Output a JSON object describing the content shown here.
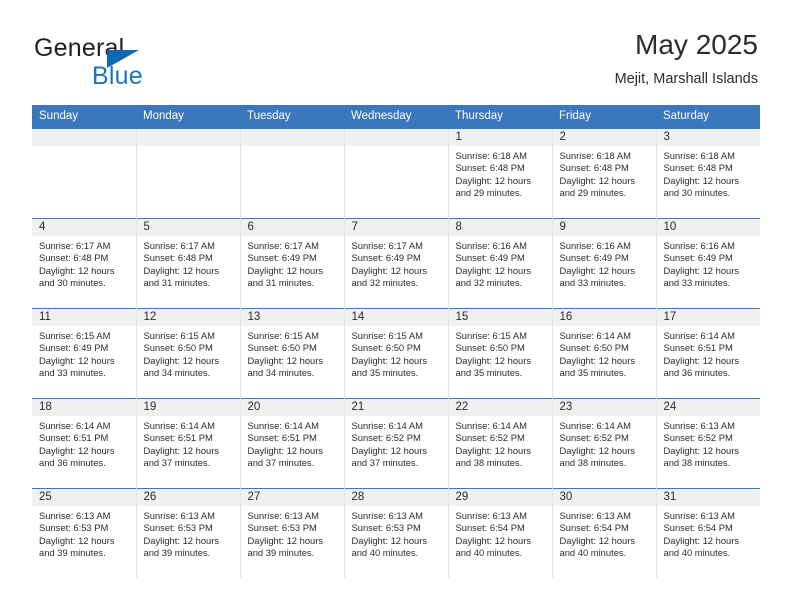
{
  "logo": {
    "primary_text": "General",
    "secondary_text": "Blue",
    "primary_color": "#231f20",
    "secondary_color": "#1b75bb",
    "triangle_color": "#1068b3"
  },
  "header": {
    "title": "May 2025",
    "subtitle": "Mejit, Marshall Islands"
  },
  "colors": {
    "header_row_bg": "#3a77bd",
    "header_row_text": "#ffffff",
    "day_number_band": "#f0f0f0",
    "cell_bg": "#ffffff",
    "row_divider": "#3a77bd",
    "text": "#2b2b2b"
  },
  "weekday_headers": [
    "Sunday",
    "Monday",
    "Tuesday",
    "Wednesday",
    "Thursday",
    "Friday",
    "Saturday"
  ],
  "weeks": [
    [
      {
        "day": "",
        "empty": true
      },
      {
        "day": "",
        "empty": true
      },
      {
        "day": "",
        "empty": true
      },
      {
        "day": "",
        "empty": true
      },
      {
        "day": "1",
        "sunrise": "Sunrise: 6:18 AM",
        "sunset": "Sunset: 6:48 PM",
        "daylight_line1": "Daylight: 12 hours",
        "daylight_line2": "and 29 minutes."
      },
      {
        "day": "2",
        "sunrise": "Sunrise: 6:18 AM",
        "sunset": "Sunset: 6:48 PM",
        "daylight_line1": "Daylight: 12 hours",
        "daylight_line2": "and 29 minutes."
      },
      {
        "day": "3",
        "sunrise": "Sunrise: 6:18 AM",
        "sunset": "Sunset: 6:48 PM",
        "daylight_line1": "Daylight: 12 hours",
        "daylight_line2": "and 30 minutes."
      }
    ],
    [
      {
        "day": "4",
        "sunrise": "Sunrise: 6:17 AM",
        "sunset": "Sunset: 6:48 PM",
        "daylight_line1": "Daylight: 12 hours",
        "daylight_line2": "and 30 minutes."
      },
      {
        "day": "5",
        "sunrise": "Sunrise: 6:17 AM",
        "sunset": "Sunset: 6:48 PM",
        "daylight_line1": "Daylight: 12 hours",
        "daylight_line2": "and 31 minutes."
      },
      {
        "day": "6",
        "sunrise": "Sunrise: 6:17 AM",
        "sunset": "Sunset: 6:49 PM",
        "daylight_line1": "Daylight: 12 hours",
        "daylight_line2": "and 31 minutes."
      },
      {
        "day": "7",
        "sunrise": "Sunrise: 6:17 AM",
        "sunset": "Sunset: 6:49 PM",
        "daylight_line1": "Daylight: 12 hours",
        "daylight_line2": "and 32 minutes."
      },
      {
        "day": "8",
        "sunrise": "Sunrise: 6:16 AM",
        "sunset": "Sunset: 6:49 PM",
        "daylight_line1": "Daylight: 12 hours",
        "daylight_line2": "and 32 minutes."
      },
      {
        "day": "9",
        "sunrise": "Sunrise: 6:16 AM",
        "sunset": "Sunset: 6:49 PM",
        "daylight_line1": "Daylight: 12 hours",
        "daylight_line2": "and 33 minutes."
      },
      {
        "day": "10",
        "sunrise": "Sunrise: 6:16 AM",
        "sunset": "Sunset: 6:49 PM",
        "daylight_line1": "Daylight: 12 hours",
        "daylight_line2": "and 33 minutes."
      }
    ],
    [
      {
        "day": "11",
        "sunrise": "Sunrise: 6:15 AM",
        "sunset": "Sunset: 6:49 PM",
        "daylight_line1": "Daylight: 12 hours",
        "daylight_line2": "and 33 minutes."
      },
      {
        "day": "12",
        "sunrise": "Sunrise: 6:15 AM",
        "sunset": "Sunset: 6:50 PM",
        "daylight_line1": "Daylight: 12 hours",
        "daylight_line2": "and 34 minutes."
      },
      {
        "day": "13",
        "sunrise": "Sunrise: 6:15 AM",
        "sunset": "Sunset: 6:50 PM",
        "daylight_line1": "Daylight: 12 hours",
        "daylight_line2": "and 34 minutes."
      },
      {
        "day": "14",
        "sunrise": "Sunrise: 6:15 AM",
        "sunset": "Sunset: 6:50 PM",
        "daylight_line1": "Daylight: 12 hours",
        "daylight_line2": "and 35 minutes."
      },
      {
        "day": "15",
        "sunrise": "Sunrise: 6:15 AM",
        "sunset": "Sunset: 6:50 PM",
        "daylight_line1": "Daylight: 12 hours",
        "daylight_line2": "and 35 minutes."
      },
      {
        "day": "16",
        "sunrise": "Sunrise: 6:14 AM",
        "sunset": "Sunset: 6:50 PM",
        "daylight_line1": "Daylight: 12 hours",
        "daylight_line2": "and 35 minutes."
      },
      {
        "day": "17",
        "sunrise": "Sunrise: 6:14 AM",
        "sunset": "Sunset: 6:51 PM",
        "daylight_line1": "Daylight: 12 hours",
        "daylight_line2": "and 36 minutes."
      }
    ],
    [
      {
        "day": "18",
        "sunrise": "Sunrise: 6:14 AM",
        "sunset": "Sunset: 6:51 PM",
        "daylight_line1": "Daylight: 12 hours",
        "daylight_line2": "and 36 minutes."
      },
      {
        "day": "19",
        "sunrise": "Sunrise: 6:14 AM",
        "sunset": "Sunset: 6:51 PM",
        "daylight_line1": "Daylight: 12 hours",
        "daylight_line2": "and 37 minutes."
      },
      {
        "day": "20",
        "sunrise": "Sunrise: 6:14 AM",
        "sunset": "Sunset: 6:51 PM",
        "daylight_line1": "Daylight: 12 hours",
        "daylight_line2": "and 37 minutes."
      },
      {
        "day": "21",
        "sunrise": "Sunrise: 6:14 AM",
        "sunset": "Sunset: 6:52 PM",
        "daylight_line1": "Daylight: 12 hours",
        "daylight_line2": "and 37 minutes."
      },
      {
        "day": "22",
        "sunrise": "Sunrise: 6:14 AM",
        "sunset": "Sunset: 6:52 PM",
        "daylight_line1": "Daylight: 12 hours",
        "daylight_line2": "and 38 minutes."
      },
      {
        "day": "23",
        "sunrise": "Sunrise: 6:14 AM",
        "sunset": "Sunset: 6:52 PM",
        "daylight_line1": "Daylight: 12 hours",
        "daylight_line2": "and 38 minutes."
      },
      {
        "day": "24",
        "sunrise": "Sunrise: 6:13 AM",
        "sunset": "Sunset: 6:52 PM",
        "daylight_line1": "Daylight: 12 hours",
        "daylight_line2": "and 38 minutes."
      }
    ],
    [
      {
        "day": "25",
        "sunrise": "Sunrise: 6:13 AM",
        "sunset": "Sunset: 6:53 PM",
        "daylight_line1": "Daylight: 12 hours",
        "daylight_line2": "and 39 minutes."
      },
      {
        "day": "26",
        "sunrise": "Sunrise: 6:13 AM",
        "sunset": "Sunset: 6:53 PM",
        "daylight_line1": "Daylight: 12 hours",
        "daylight_line2": "and 39 minutes."
      },
      {
        "day": "27",
        "sunrise": "Sunrise: 6:13 AM",
        "sunset": "Sunset: 6:53 PM",
        "daylight_line1": "Daylight: 12 hours",
        "daylight_line2": "and 39 minutes."
      },
      {
        "day": "28",
        "sunrise": "Sunrise: 6:13 AM",
        "sunset": "Sunset: 6:53 PM",
        "daylight_line1": "Daylight: 12 hours",
        "daylight_line2": "and 40 minutes."
      },
      {
        "day": "29",
        "sunrise": "Sunrise: 6:13 AM",
        "sunset": "Sunset: 6:54 PM",
        "daylight_line1": "Daylight: 12 hours",
        "daylight_line2": "and 40 minutes."
      },
      {
        "day": "30",
        "sunrise": "Sunrise: 6:13 AM",
        "sunset": "Sunset: 6:54 PM",
        "daylight_line1": "Daylight: 12 hours",
        "daylight_line2": "and 40 minutes."
      },
      {
        "day": "31",
        "sunrise": "Sunrise: 6:13 AM",
        "sunset": "Sunset: 6:54 PM",
        "daylight_line1": "Daylight: 12 hours",
        "daylight_line2": "and 40 minutes."
      }
    ]
  ]
}
